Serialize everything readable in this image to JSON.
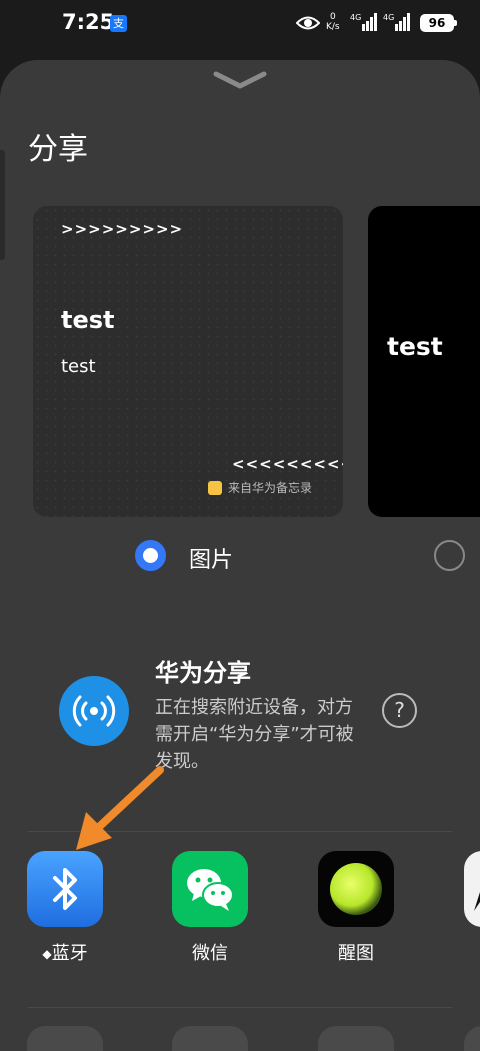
{
  "status": {
    "time": "7:25",
    "alipay_badge": "支",
    "net_speed_top": "0",
    "net_speed_bottom": "K/s",
    "sim1": "4G",
    "sim2": "4G",
    "battery": "96"
  },
  "sheet": {
    "title": "分享",
    "card1": {
      "arrows_top": ">>>>>>>>>",
      "heading": "test",
      "body": "test",
      "arrows_bottom": "<<<<<<<<<",
      "source": "来自华为备忘录"
    },
    "card2": {
      "text": "test"
    },
    "option_label": "图片",
    "huawei_share": {
      "title": "华为分享",
      "description": "正在搜索附近设备，对方需开启“华为分享”才可被发现。",
      "help": "?"
    },
    "apps": [
      {
        "label": "蓝牙",
        "prefix": "◆"
      },
      {
        "label": "微信"
      },
      {
        "label": "醒图"
      }
    ]
  },
  "colors": {
    "sheet_bg": "#3a3a3a",
    "accent": "#3478f6",
    "bluetooth": "#2f7fe8",
    "wechat": "#07c160",
    "annotation_arrow": "#f08a2a"
  }
}
